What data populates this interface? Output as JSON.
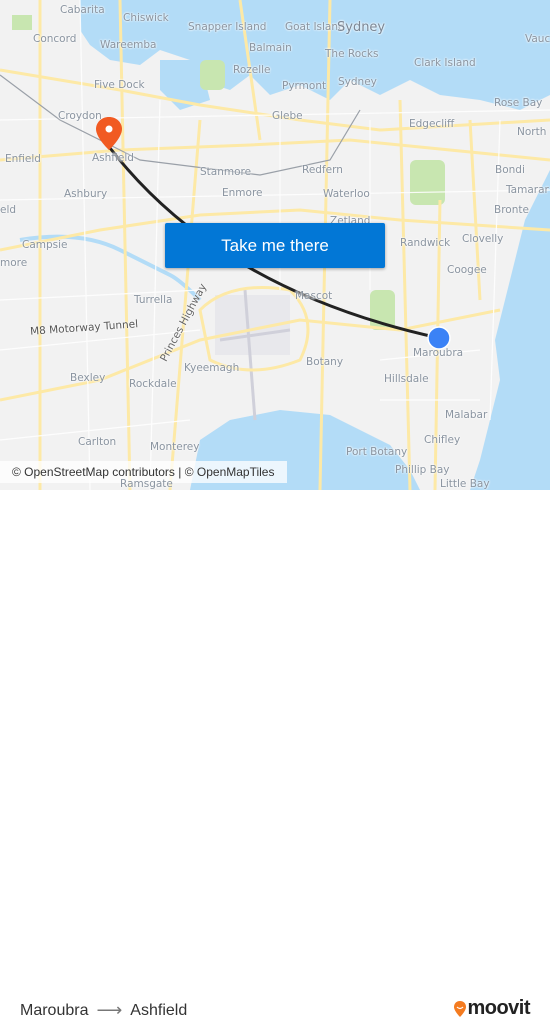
{
  "map": {
    "labels": [
      "Cabarita",
      "Chiswick",
      "Snapper Island",
      "Goat Island",
      "Sydney",
      "Concord",
      "Wareemba",
      "Balmain",
      "The Rocks",
      "Clark Island",
      "Vauc",
      "Rozelle",
      "Five Dock",
      "Pyrmont",
      "Sydney",
      "Rose Bay",
      "Croydon",
      "Glebe",
      "Edgecliff",
      "North",
      "Enfield",
      "Ashfield",
      "Stanmore",
      "Redfern",
      "Bondi",
      "Ashbury",
      "Enmore",
      "Waterloo",
      "Tamarar",
      "eld",
      "Zetland",
      "Bronte",
      "Campsie",
      "Randwick",
      "Clovelly",
      "more",
      "Coogee",
      "Turrella",
      "Mascot",
      "Princes Highway",
      "M8 Motorway Tunnel",
      "Maroubra",
      "Kyeemagh",
      "Botany",
      "Bexley",
      "Rockdale",
      "Hillsdale",
      "Malabar",
      "Carlton",
      "Monterey",
      "Chifley",
      "Port Botany",
      "Phillip Bay",
      "Little Bay",
      "Ramsgate"
    ],
    "colors": {
      "land": "#f2f2f2",
      "water": "#b3dcf7",
      "road": "#fde9a6",
      "park": "#c8e6b0",
      "route": "#222222",
      "origin": "#3b82f6",
      "destination": "#f15a22"
    },
    "origin_marker_icon": "location-dot-icon",
    "destination_marker_icon": "map-pin-icon"
  },
  "cta": {
    "label": "Take me there"
  },
  "attribution": "© OpenStreetMap contributors | © OpenMapTiles",
  "footer": {
    "from": "Maroubra",
    "to": "Ashfield",
    "arrow_icon": "arrow-right-icon",
    "brand": "moovit"
  }
}
